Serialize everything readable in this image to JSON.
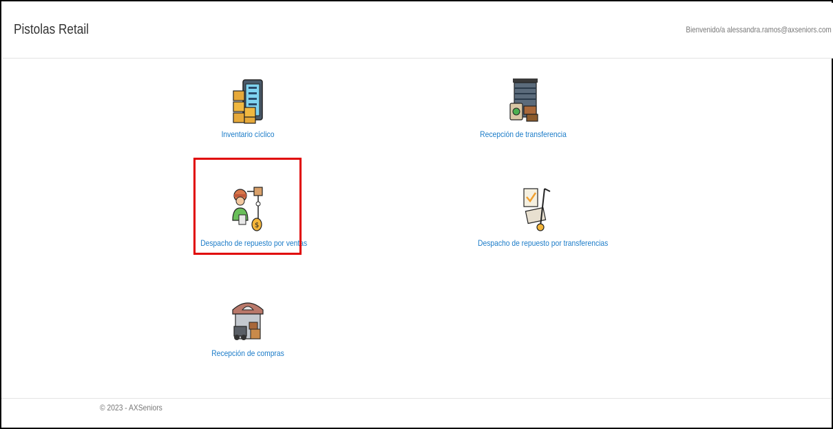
{
  "header": {
    "brand": "Pistolas Retail",
    "welcome": "Bienvenido/a alessandra.ramos@axseniors.com"
  },
  "tiles": [
    {
      "label": "Inventario cíclico",
      "icon": "inventory-shelf-icon"
    },
    {
      "label": "Recepción de transferencia",
      "icon": "warehouse-transfer-icon"
    },
    {
      "label": "Despacho de repuesto por ventas",
      "icon": "sales-dispatch-icon",
      "highlighted": true
    },
    {
      "label": "Despacho de repuesto por transferencias",
      "icon": "transfer-dispatch-icon"
    },
    {
      "label": "Recepción de compras",
      "icon": "purchase-receipt-icon"
    }
  ],
  "footer": {
    "text": "© 2023 - AXSeniors"
  },
  "colors": {
    "link": "#1a7bc8",
    "highlight": "#e00000",
    "text": "#333333"
  }
}
